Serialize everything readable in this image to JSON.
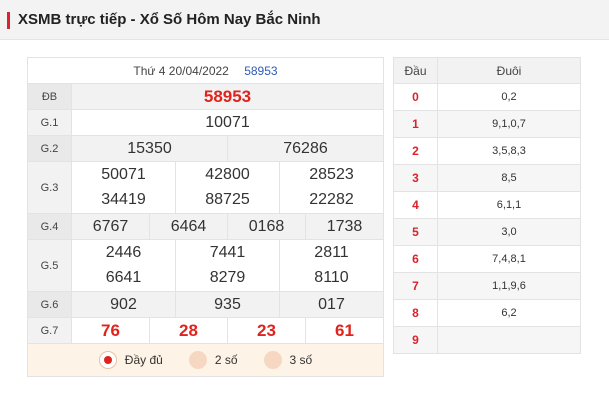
{
  "header": {
    "title": "XSMB trực tiếp - Xổ Số Hôm Nay Bắc Ninh"
  },
  "result": {
    "date": "Thứ 4 20/04/2022",
    "code": "58953",
    "prizes": {
      "db": {
        "label": "ĐB",
        "value": "58953"
      },
      "g1": {
        "label": "G.1",
        "values": [
          "10071"
        ]
      },
      "g2": {
        "label": "G.2",
        "values": [
          "15350",
          "76286"
        ]
      },
      "g3": {
        "label": "G.3",
        "values": [
          "50071",
          "42800",
          "28523",
          "34419",
          "88725",
          "22282"
        ]
      },
      "g4": {
        "label": "G.4",
        "values": [
          "6767",
          "6464",
          "0168",
          "1738"
        ]
      },
      "g5": {
        "label": "G.5",
        "values": [
          "2446",
          "7441",
          "2811",
          "6641",
          "8279",
          "8110"
        ]
      },
      "g6": {
        "label": "G.6",
        "values": [
          "902",
          "935",
          "017"
        ]
      },
      "g7": {
        "label": "G.7",
        "values": [
          "76",
          "28",
          "23",
          "61"
        ]
      }
    }
  },
  "display_options": {
    "selected": "Đầy đủ",
    "items": [
      "Đầy đủ",
      "2 số",
      "3 số"
    ]
  },
  "loto": {
    "head_label": "Đầu",
    "tail_label": "Đuôi",
    "rows": [
      {
        "dau": "0",
        "duoi": "0,2"
      },
      {
        "dau": "1",
        "duoi": "9,1,0,7"
      },
      {
        "dau": "2",
        "duoi": "3,5,8,3"
      },
      {
        "dau": "3",
        "duoi": "8,5"
      },
      {
        "dau": "4",
        "duoi": "6,1,1"
      },
      {
        "dau": "5",
        "duoi": "3,0"
      },
      {
        "dau": "6",
        "duoi": "7,4,8,1"
      },
      {
        "dau": "7",
        "duoi": "1,1,9,6"
      },
      {
        "dau": "8",
        "duoi": "6,2"
      },
      {
        "dau": "9",
        "duoi": ""
      }
    ]
  },
  "colors": {
    "accent": "#d9232d",
    "link": "#2f5bb7",
    "radio_bg": "#fdf3e6"
  }
}
